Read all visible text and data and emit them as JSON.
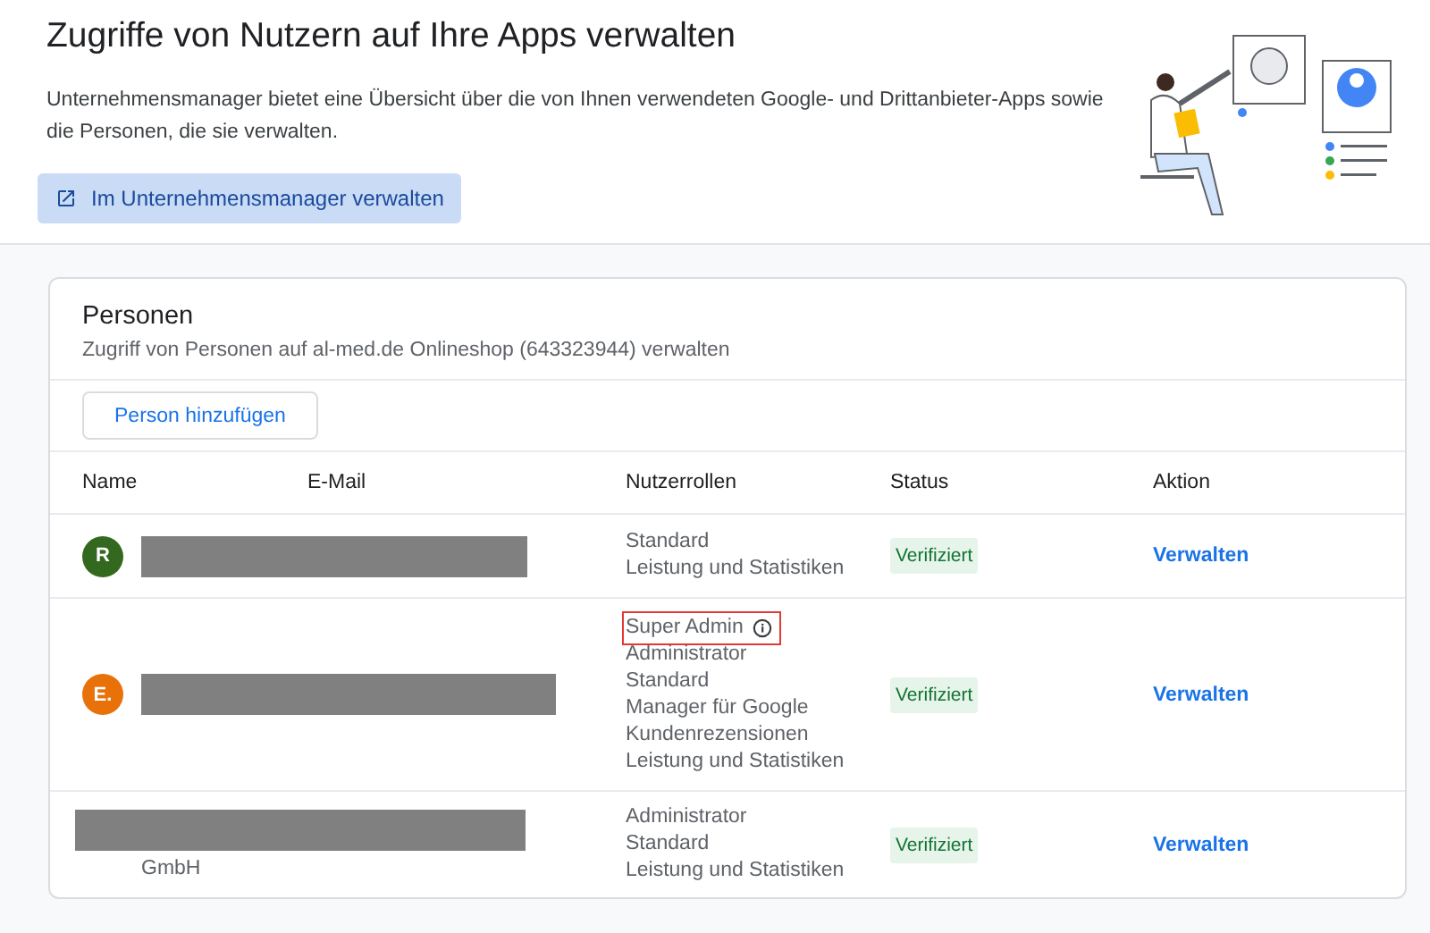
{
  "header": {
    "title": "Zugriffe von Nutzern auf Ihre Apps verwalten",
    "description": "Unternehmensmanager bietet eine Übersicht über die von Ihnen verwendeten Google- und Drittanbieter-Apps sowie die Personen, die sie verwalten.",
    "button": "Im Unternehmensmanager verwalten"
  },
  "people": {
    "title": "Personen",
    "subtitle": "Zugriff von Personen auf al-med.de Onlineshop (643323944) verwalten",
    "add_button": "Person hinzufügen",
    "columns": [
      "Name",
      "E-Mail",
      "Nutzerrollen",
      "Status",
      "Aktion"
    ],
    "rows": [
      {
        "avatar": "R",
        "color": "#33691e",
        "roles": [
          {
            "label": "Standard",
            "highlighted": false,
            "info": false
          },
          {
            "label": "Leistung und Statistiken",
            "highlighted": false,
            "info": false
          }
        ],
        "status": "Verifiziert",
        "action": "Verwalten"
      },
      {
        "avatar": "E.",
        "color": "#e8710a",
        "roles": [
          {
            "label": "Super Admin",
            "highlighted": true,
            "info": true
          },
          {
            "label": "Administrator",
            "highlighted": false,
            "info": false
          },
          {
            "label": "Standard",
            "highlighted": false,
            "info": false
          },
          {
            "label": "Manager für Google",
            "highlighted": false,
            "info": false
          },
          {
            "label": "Kundenrezensionen",
            "highlighted": false,
            "info": false
          },
          {
            "label": "Leistung und Statistiken",
            "highlighted": false,
            "info": false
          }
        ],
        "status": "Verifiziert",
        "action": "Verwalten"
      },
      {
        "name": "GmbH",
        "roles": [
          {
            "label": "Administrator",
            "highlighted": false,
            "info": false
          },
          {
            "label": "Standard",
            "highlighted": false,
            "info": false
          },
          {
            "label": "Leistung und Statistiken",
            "highlighted": false,
            "info": false
          }
        ],
        "status": "Verifiziert",
        "action": "Verwalten"
      }
    ]
  }
}
